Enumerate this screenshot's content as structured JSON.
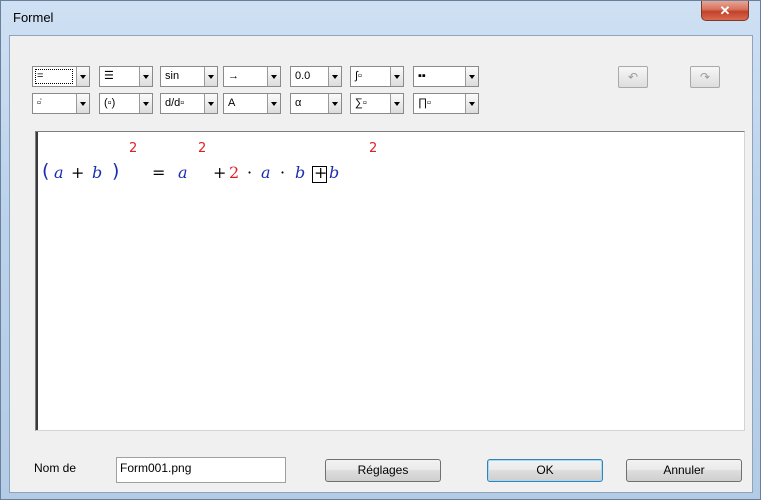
{
  "window": {
    "title": "Formel",
    "close_glyph": "✕"
  },
  "toolbar": {
    "row1": [
      {
        "name": "relation-combo",
        "face": "="
      },
      {
        "name": "fraction-layout-combo",
        "face": "☰"
      },
      {
        "name": "function-combo",
        "face": "sin"
      },
      {
        "name": "arrow-combo",
        "face": "→"
      },
      {
        "name": "number-format-combo",
        "face": "0.0"
      },
      {
        "name": "integral-combo",
        "face": "∫▫"
      },
      {
        "name": "spacing-combo",
        "face": "▪▪"
      }
    ],
    "row2": [
      {
        "name": "dot-accent-combo",
        "face": "▫̇"
      },
      {
        "name": "brackets-combo",
        "face": "(▫)"
      },
      {
        "name": "derivative-combo",
        "face": "d/d▫"
      },
      {
        "name": "text-style-combo",
        "face": "A"
      },
      {
        "name": "greek-combo",
        "face": "α"
      },
      {
        "name": "sum-combo",
        "face": "∑▫"
      },
      {
        "name": "product-combo",
        "face": "∏▫"
      }
    ],
    "undo_glyph": "↶",
    "redo_glyph": "↷"
  },
  "formula": {
    "lparen": "(",
    "a1": "a",
    "plus1": "+",
    "b1": "b",
    "rparen": ")",
    "exp1": "2",
    "equals": "=",
    "a2": "a",
    "exp2": "2",
    "plus2": "+",
    "two": "2",
    "dot1": "·",
    "a3": "a",
    "dot2": "·",
    "b2": "b",
    "plus3": "+",
    "b3": "b",
    "exp3": "2"
  },
  "footer": {
    "name_label": "Nom de",
    "filename_value": "Form001.png",
    "settings_label": "Réglages",
    "ok_label": "OK",
    "cancel_label": "Annuler"
  },
  "colors": {
    "variable": "#1b2db3",
    "number": "#e02020"
  }
}
